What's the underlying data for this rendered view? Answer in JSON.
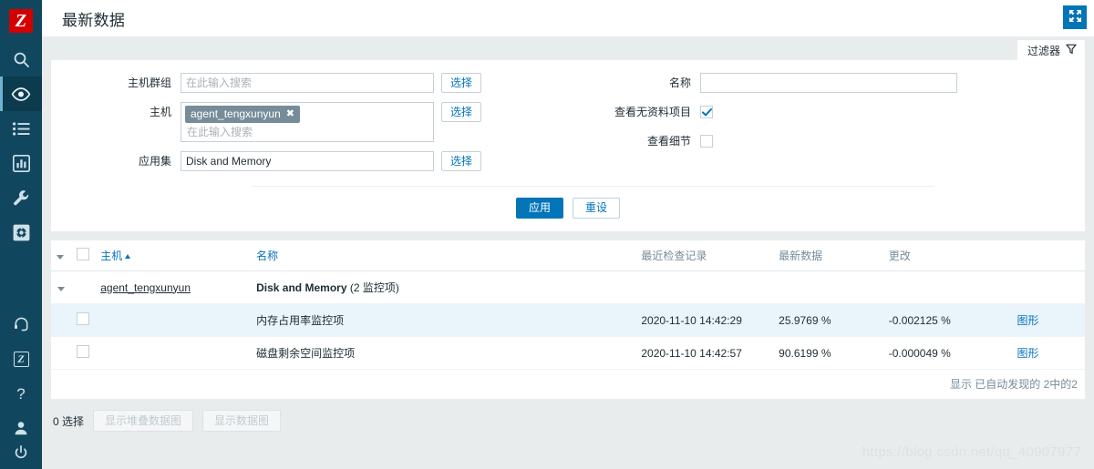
{
  "sidebar": {
    "logo_label": "Z",
    "items": [
      {
        "name": "search-icon",
        "label": "搜索"
      },
      {
        "name": "monitoring-eye-icon",
        "label": "监测",
        "active": true
      },
      {
        "name": "inventory-list-icon",
        "label": "资产记录"
      },
      {
        "name": "reports-chart-icon",
        "label": "报表"
      },
      {
        "name": "configuration-wrench-icon",
        "label": "配置"
      },
      {
        "name": "administration-gear-icon",
        "label": "管理"
      }
    ],
    "bottom_items": [
      {
        "name": "support-headset-icon",
        "label": "支持"
      },
      {
        "name": "zabbix-integrations-icon",
        "label": "Z"
      },
      {
        "name": "help-question-icon",
        "label": "?"
      },
      {
        "name": "user-profile-icon",
        "label": "用户设置"
      },
      {
        "name": "signout-power-icon",
        "label": "登出"
      }
    ]
  },
  "header": {
    "title": "最新数据",
    "kiosk_button_label": "全屏"
  },
  "filter": {
    "tab_label": "过滤器",
    "host_groups": {
      "label": "主机群组",
      "value": "",
      "placeholder": "在此输入搜索",
      "select_label": "选择"
    },
    "hosts": {
      "label": "主机",
      "chip": "agent_tengxunyun",
      "chip_remove": "✖",
      "placeholder": "在此输入搜索",
      "select_label": "选择"
    },
    "application": {
      "label": "应用集",
      "value": "Disk and Memory",
      "placeholder": "",
      "select_label": "选择"
    },
    "name": {
      "label": "名称",
      "value": "",
      "placeholder": ""
    },
    "show_items_without_data": {
      "label": "查看无资料项目",
      "checked": true
    },
    "show_details": {
      "label": "查看细节",
      "checked": false
    },
    "apply_label": "应用",
    "reset_label": "重设"
  },
  "table": {
    "columns": {
      "host": "主机",
      "name": "名称",
      "last_check": "最近检查记录",
      "last_value": "最新数据",
      "change": "更改"
    },
    "sort_column": "主机",
    "sort_direction": "asc",
    "group_row": {
      "host": "agent_tengxunyun",
      "application": "Disk and Memory",
      "count_text": "(2 监控项)"
    },
    "rows": [
      {
        "name": "内存占用率监控项",
        "last_check": "2020-11-10 14:42:29",
        "last_value": "25.9769 %",
        "change": "-0.002125 %",
        "graph_label": "图形",
        "highlighted": true
      },
      {
        "name": "磁盘剩余空间监控项",
        "last_check": "2020-11-10 14:42:57",
        "last_value": "90.6199 %",
        "change": "-0.000049 %",
        "graph_label": "图形",
        "highlighted": false
      }
    ],
    "footer_text": "显示 已自动发现的 2中的2"
  },
  "actions": {
    "selected_text": "0 选择",
    "show_stacked_graph_label": "显示堆叠数据图",
    "show_graph_label": "显示数据图"
  },
  "watermark": "https://blog.csdn.net/qq_40907977",
  "colors": {
    "sidebar_bg": "#10475f",
    "accent": "#0275b8",
    "logo_red": "#d40000",
    "chip_bg": "#768d99",
    "row_highlight": "#eaf4fb",
    "page_bg": "#e8ecec"
  }
}
